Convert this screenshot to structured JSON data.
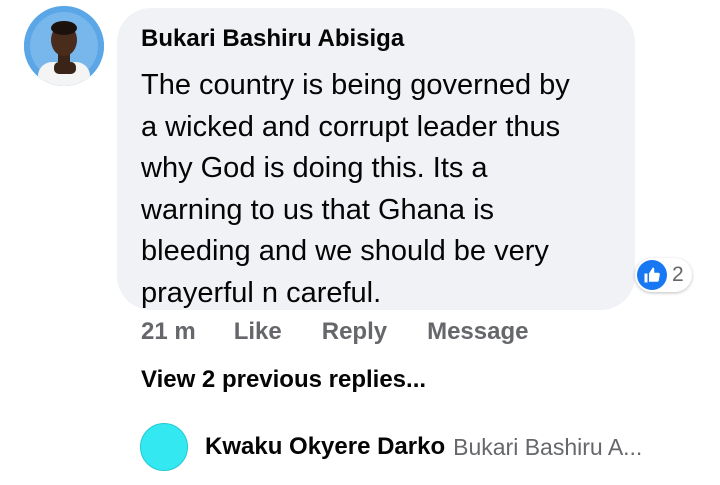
{
  "comment": {
    "author": "Bukari Bashiru Abisiga",
    "text": "The country is being governed by\na wicked and corrupt leader thus\nwhy God is doing this. Its a\nwarning to us that Ghana is\nbleeding and we should be very\nprayerful n careful.",
    "reactions": {
      "icon": "like-thumbs-up-icon",
      "count": "2",
      "color": "#1877f2"
    },
    "meta": {
      "time": "21 m",
      "like_label": "Like",
      "reply_label": "Reply",
      "message_label": "Message"
    }
  },
  "replies": {
    "view_previous_label": "View 2 previous replies...",
    "latest": {
      "author": "Kwaku Okyere Darko",
      "preview": "Bukari Bashiru A...",
      "avatar_color": "#33e8f0"
    }
  }
}
